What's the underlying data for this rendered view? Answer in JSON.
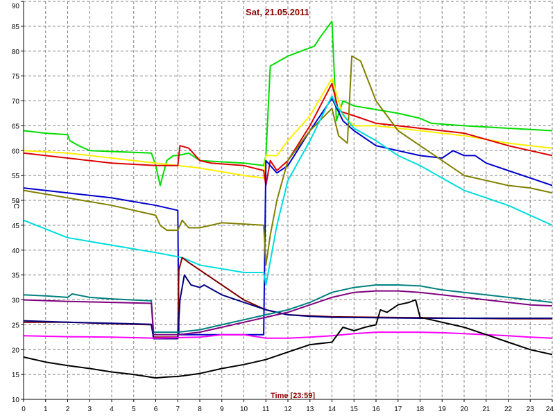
{
  "chart_data": {
    "type": "line",
    "title": "Sat, 21.05.2011",
    "xlabel": "Time [23:59]",
    "ylabel": "°C",
    "xlim": [
      0,
      24
    ],
    "ylim": [
      10,
      90
    ],
    "xticks": [
      0,
      1,
      2,
      3,
      4,
      5,
      6,
      7,
      8,
      9,
      10,
      11,
      12,
      13,
      14,
      15,
      16,
      17,
      18,
      19,
      20,
      21,
      22,
      23,
      24
    ],
    "yticks": [
      10,
      15,
      20,
      25,
      30,
      35,
      40,
      45,
      50,
      55,
      60,
      65,
      70,
      75,
      80,
      85,
      90
    ],
    "grid": true,
    "colors": {
      "grid": "#808080",
      "axis": "#000000",
      "title": "#8b0000"
    },
    "series": [
      {
        "color": "#00dd00",
        "x": [
          0,
          1,
          2,
          2.1,
          2.5,
          3,
          5.8,
          6,
          6.2,
          6.5,
          6.8,
          7,
          7.5,
          8,
          10,
          10.9,
          11,
          11.2,
          12,
          13.2,
          13.5,
          14,
          14.2,
          14.5,
          15,
          17,
          18,
          18.5,
          20,
          22,
          24
        ],
        "y": [
          64,
          63.5,
          63.2,
          62,
          61,
          60,
          59.5,
          57,
          53,
          58,
          59,
          59,
          59.5,
          58,
          57.5,
          57,
          59,
          77,
          79,
          81,
          83,
          86,
          66,
          70,
          69,
          67.5,
          66.5,
          65.5,
          65,
          64.5,
          64
        ]
      },
      {
        "color": "#ffee00",
        "x": [
          0,
          2,
          4,
          6,
          8,
          10,
          10.9,
          11,
          11.5,
          12,
          13,
          14,
          14.5,
          15,
          16,
          18,
          20,
          22,
          24
        ],
        "y": [
          60,
          59.5,
          58.5,
          57.5,
          56.5,
          55,
          54.5,
          59,
          59,
          62,
          67,
          74.5,
          67,
          65,
          65,
          64,
          63,
          61.5,
          60.5
        ]
      },
      {
        "color": "#dd0000",
        "x": [
          0,
          2,
          4,
          6,
          7,
          7.1,
          7.5,
          8,
          8.5,
          10,
          10.9,
          11,
          11.2,
          11.5,
          12,
          13,
          14,
          14.3,
          15,
          16,
          18,
          20,
          22,
          24
        ],
        "y": [
          59.5,
          58.5,
          57.5,
          57,
          57,
          61,
          60.5,
          58,
          57.5,
          57,
          56,
          53,
          58,
          56,
          58,
          65,
          73.5,
          68,
          67,
          65.5,
          64.5,
          63.5,
          61,
          59
        ]
      },
      {
        "color": "#0000cc",
        "x": [
          0,
          2,
          4,
          6,
          7,
          7.05,
          8,
          10,
          10.9,
          11,
          11.5,
          12,
          13,
          14,
          14.5,
          15,
          16,
          17,
          18,
          19,
          19.5,
          20,
          20.5,
          21,
          22,
          23,
          24
        ],
        "y": [
          52.5,
          51.5,
          50.5,
          49,
          48,
          23,
          23,
          23,
          23,
          58,
          55.5,
          57,
          64,
          70.5,
          66,
          64,
          61,
          60,
          59,
          58.5,
          60,
          59,
          59,
          57.5,
          56,
          54.5,
          53
        ]
      },
      {
        "color": "#808000",
        "x": [
          0,
          2,
          4,
          6,
          6.2,
          6.5,
          7,
          7.2,
          7.5,
          8,
          9,
          10.9,
          11,
          11.2,
          11.5,
          12,
          13,
          14,
          14.3,
          14.7,
          14.9,
          15.3,
          16,
          17,
          18,
          19,
          20,
          21,
          22,
          23,
          24
        ],
        "y": [
          52,
          50.5,
          49,
          47,
          45,
          44,
          44,
          46,
          44.5,
          44.5,
          45.5,
          45,
          37,
          43,
          50,
          58,
          64,
          68.5,
          63,
          61.5,
          79,
          78,
          70,
          64,
          61,
          58,
          55,
          54,
          53,
          52.5,
          51.5
        ]
      },
      {
        "color": "#00dddd",
        "x": [
          0,
          2,
          4,
          6,
          7.2,
          8,
          10,
          10.9,
          11,
          11.5,
          12,
          13,
          14,
          14.2,
          15,
          16,
          17,
          18,
          20,
          22,
          24
        ],
        "y": [
          46,
          42.5,
          41,
          39.5,
          38.5,
          37,
          35.5,
          35.5,
          33,
          45,
          54,
          62,
          71,
          69,
          64.5,
          62,
          59,
          57,
          52,
          49,
          45
        ]
      },
      {
        "color": "#800000",
        "x": [
          0,
          2,
          4,
          5.8,
          5.9,
          7,
          7.05,
          7.2,
          7.5,
          8,
          9,
          10,
          11,
          12,
          13,
          14,
          18,
          20,
          22,
          24
        ],
        "y": [
          25.5,
          25.5,
          25.2,
          25,
          22.5,
          22.5,
          36,
          38.5,
          37.5,
          36,
          33,
          30,
          28,
          27,
          26.8,
          26.6,
          26.4,
          26.3,
          26.2,
          26.2
        ]
      },
      {
        "color": "#000080",
        "x": [
          0,
          2,
          4,
          5.8,
          5.9,
          7,
          7.1,
          7.3,
          7.6,
          8,
          8.2,
          9,
          10,
          11,
          12,
          13,
          14,
          16,
          18,
          20,
          22,
          24
        ],
        "y": [
          25.8,
          25.5,
          25.3,
          25.1,
          22.2,
          22.2,
          30,
          35,
          33,
          32.5,
          33,
          31,
          29.5,
          28,
          27,
          26.7,
          26.5,
          26.4,
          26.3,
          26.3,
          26.3,
          26.3
        ]
      },
      {
        "color": "#008080",
        "x": [
          0,
          1,
          2,
          2.2,
          3,
          4,
          5.8,
          5.9,
          7,
          8,
          9,
          10,
          11,
          12,
          13,
          14,
          15,
          16,
          17,
          18,
          19,
          20,
          21,
          22,
          23,
          24
        ],
        "y": [
          31,
          30.8,
          30.5,
          31.2,
          30.5,
          30.2,
          29.8,
          23.5,
          23.5,
          24,
          25,
          26,
          27,
          28,
          29.5,
          31.5,
          32.5,
          33,
          33,
          32.8,
          32,
          31.5,
          31,
          30.5,
          30,
          29.5
        ]
      },
      {
        "color": "#800080",
        "x": [
          0,
          2,
          4,
          5.8,
          5.9,
          7,
          8,
          9,
          10,
          11,
          12,
          13,
          14,
          15,
          16,
          17,
          18,
          19,
          20,
          21,
          22,
          23,
          24
        ],
        "y": [
          30,
          29.7,
          29.5,
          29.3,
          23,
          23,
          23.5,
          24.5,
          25.5,
          26.5,
          27.5,
          29,
          30.5,
          31.5,
          31.8,
          31.8,
          31.5,
          31,
          30.5,
          30,
          29.5,
          29,
          28.8
        ]
      },
      {
        "color": "#ff00ff",
        "x": [
          0,
          2,
          4,
          6,
          8,
          9,
          10,
          11,
          12,
          13,
          14,
          15,
          16,
          18,
          19,
          20,
          22,
          23,
          24
        ],
        "y": [
          22.8,
          22.6,
          22.5,
          22.3,
          22.5,
          23,
          23,
          22.3,
          22.3,
          22.5,
          22.8,
          23.2,
          23.5,
          23.5,
          23.4,
          23.2,
          22.8,
          22.5,
          22.3
        ]
      },
      {
        "color": "#000000",
        "x": [
          0,
          1,
          2,
          3,
          4,
          5,
          6,
          6.5,
          7,
          8,
          9,
          10,
          11,
          12,
          13,
          14,
          14.5,
          15,
          15.5,
          16,
          16.2,
          16.5,
          17,
          17.5,
          17.8,
          18,
          18.5,
          19,
          20,
          21,
          22,
          23,
          24
        ],
        "y": [
          18.5,
          17.5,
          16.8,
          16.2,
          15.5,
          15,
          14.3,
          14.5,
          14.6,
          15.2,
          16.2,
          17,
          18,
          19.5,
          21,
          21.5,
          24.5,
          23.8,
          24.5,
          25,
          28,
          27.5,
          29,
          29.5,
          30,
          26.5,
          26,
          25.5,
          24.5,
          23,
          21.5,
          20,
          19
        ]
      }
    ]
  }
}
